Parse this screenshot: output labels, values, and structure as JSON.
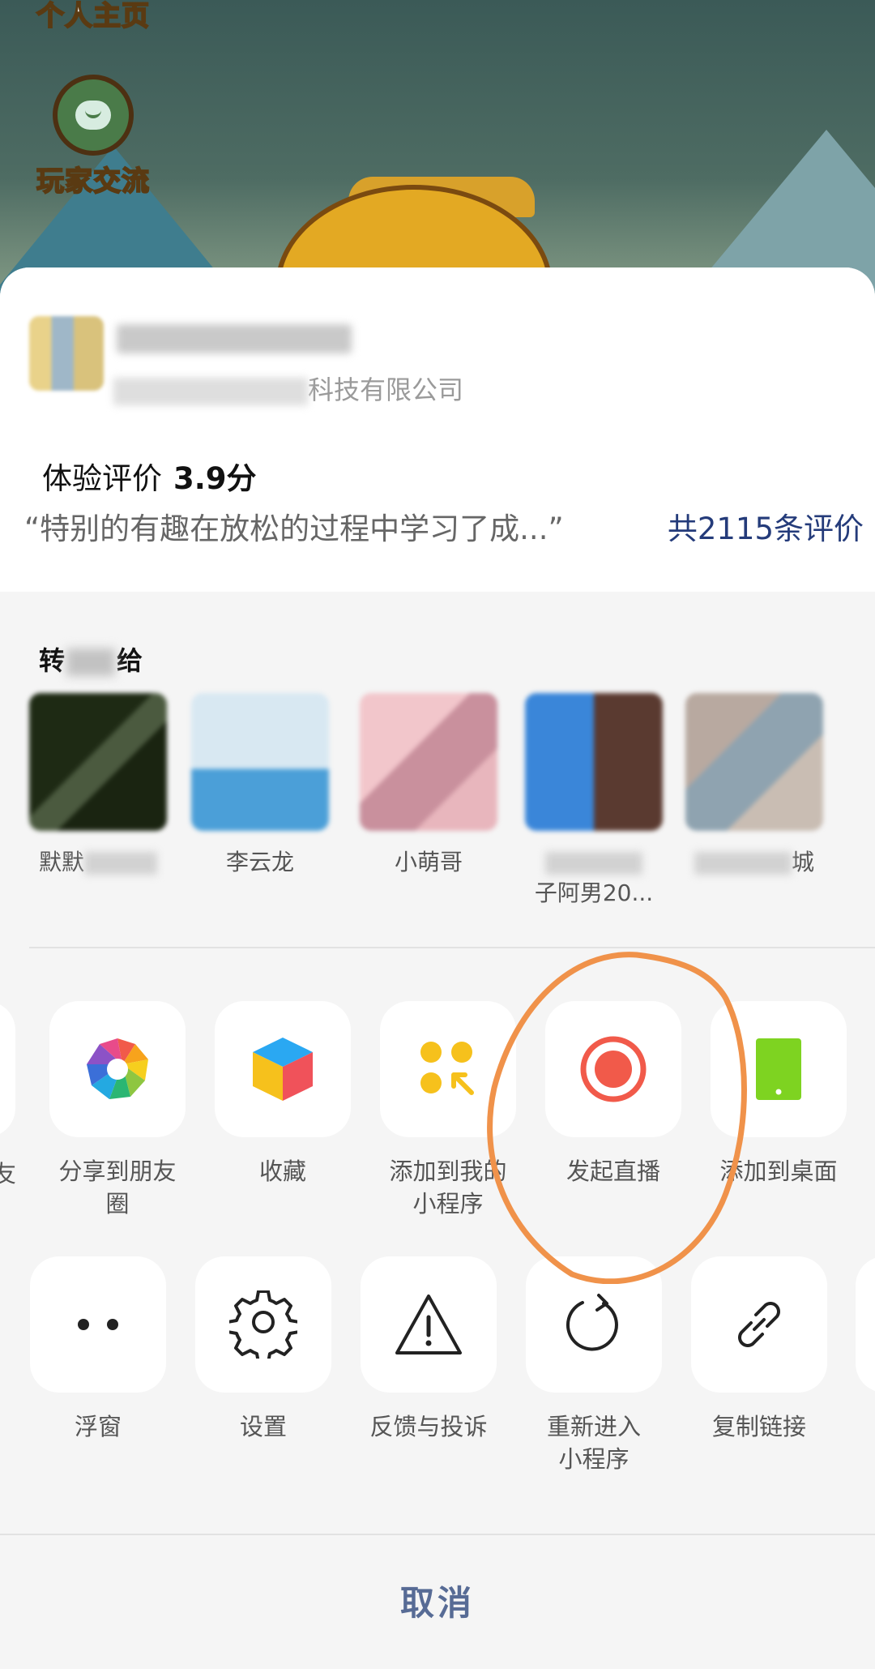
{
  "game": {
    "buttons": [
      {
        "label": "个人主页"
      },
      {
        "label": "玩家交流"
      }
    ]
  },
  "app_info": {
    "company_suffix": "科技有限公司",
    "rating_label": "体验评价",
    "rating_value": "3.9分",
    "quote": "“特别的有趣在放松的过程中学习了成...”",
    "total_reviews": "共2115条评价"
  },
  "share": {
    "title_prefix": "转",
    "title_suffix": "给",
    "contacts": [
      {
        "name": "默默"
      },
      {
        "name": "李云龙"
      },
      {
        "name": "小萌哥"
      },
      {
        "name": "子阿男20..."
      },
      {
        "name": "城"
      }
    ]
  },
  "actions_row1": [
    {
      "label": "分享到朋友圈",
      "icon": "moments-icon"
    },
    {
      "label": "收藏",
      "icon": "favorite-cube-icon"
    },
    {
      "label": "添加到我的小程序",
      "icon": "add-miniprogram-icon"
    },
    {
      "label": "发起直播",
      "icon": "live-record-icon"
    },
    {
      "label": "添加到桌面",
      "icon": "desktop-icon"
    }
  ],
  "partial_left_label": "友",
  "actions_row2": [
    {
      "label": "浮窗",
      "icon": "float-window-icon"
    },
    {
      "label": "设置",
      "icon": "gear-icon"
    },
    {
      "label": "反馈与投诉",
      "icon": "warning-icon"
    },
    {
      "label": "重新进入小程序",
      "icon": "refresh-icon"
    },
    {
      "label": "复制链接",
      "icon": "link-icon"
    }
  ],
  "cancel_label": "取消",
  "colors": {
    "accent_link": "#243b7a",
    "cancel": "#576b95",
    "live_red": "#f15a4a",
    "annotation": "#f0924a"
  }
}
